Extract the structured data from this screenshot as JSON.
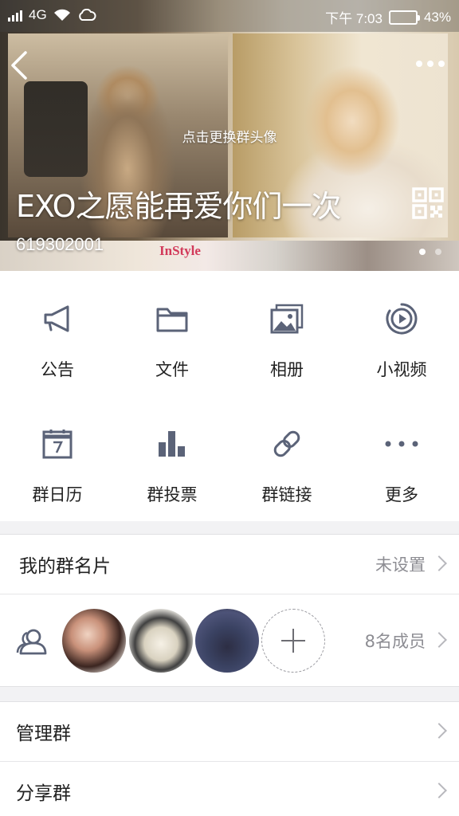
{
  "status_bar": {
    "network": "4G",
    "time": "下午 7:03",
    "battery": "43%",
    "battery_color": "#3fd149"
  },
  "header": {
    "back_icon": "chevron-left-icon",
    "more_icon": "more-dots-icon",
    "avatar_hint": "点击更换群头像",
    "group_name": "EXO之愿能再爱你们一次",
    "group_id": "619302001",
    "qr_icon": "qr-code-icon",
    "banner_text": "InStyle",
    "page_dots": 2,
    "active_dot": 0
  },
  "functions": [
    {
      "label": "公告",
      "icon": "megaphone-icon"
    },
    {
      "label": "文件",
      "icon": "folder-icon"
    },
    {
      "label": "相册",
      "icon": "album-icon"
    },
    {
      "label": "小视频",
      "icon": "video-play-icon"
    },
    {
      "label": "群日历",
      "icon": "calendar-icon"
    },
    {
      "label": "群投票",
      "icon": "bar-chart-icon"
    },
    {
      "label": "群链接",
      "icon": "link-icon"
    },
    {
      "label": "更多",
      "icon": "more-dots-icon"
    }
  ],
  "my_card": {
    "title": "我的群名片",
    "value": "未设置"
  },
  "members": {
    "icon": "members-icon",
    "count_label": "8名成员"
  },
  "settings": [
    {
      "title": "管理群"
    },
    {
      "title": "分享群"
    }
  ],
  "icon_color": "#5b6378"
}
